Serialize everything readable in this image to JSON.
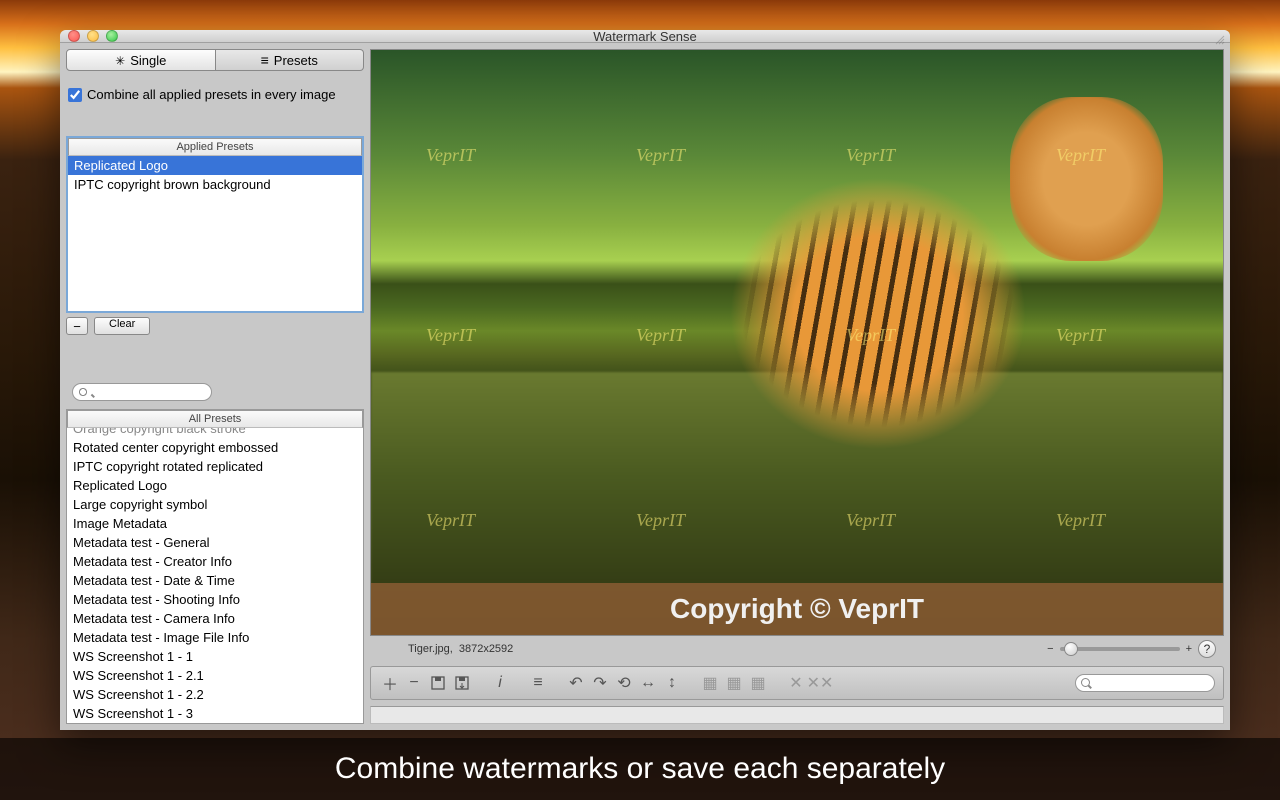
{
  "window": {
    "title": "Watermark Sense"
  },
  "segmented": {
    "single": "Single",
    "presets": "Presets"
  },
  "checkbox": {
    "combine_label": "Combine all applied presets in every image",
    "checked": true
  },
  "applied": {
    "header": "Applied Presets",
    "items": [
      "Replicated Logo",
      "IPTC copyright brown background"
    ],
    "selected_index": 0,
    "remove_label": "−",
    "clear_label": "Clear"
  },
  "all": {
    "header": "All Presets",
    "items": [
      "Orange copyright black stroke",
      "Rotated center copyright embossed",
      "IPTC copyright rotated replicated",
      "Replicated Logo",
      "Large copyright symbol",
      "Image Metadata",
      "Metadata test - General",
      "Metadata test - Creator Info",
      "Metadata test - Date & Time",
      "Metadata test - Shooting Info",
      "Metadata test - Camera Info",
      "Metadata test - Image File Info",
      "WS Screenshot 1 - 1",
      "WS Screenshot 1 - 2.1",
      "WS Screenshot 1 - 2.2",
      "WS Screenshot 1 - 3"
    ]
  },
  "preview": {
    "watermark_text": "VeprIT",
    "copyright_text": "Copyright © VeprIT",
    "status_filename": "Tiger.jpg,",
    "status_dims": "3872x2592",
    "zoom_minus": "−",
    "zoom_plus": "+",
    "help": "?"
  },
  "caption": "Combine watermarks or save each separately"
}
